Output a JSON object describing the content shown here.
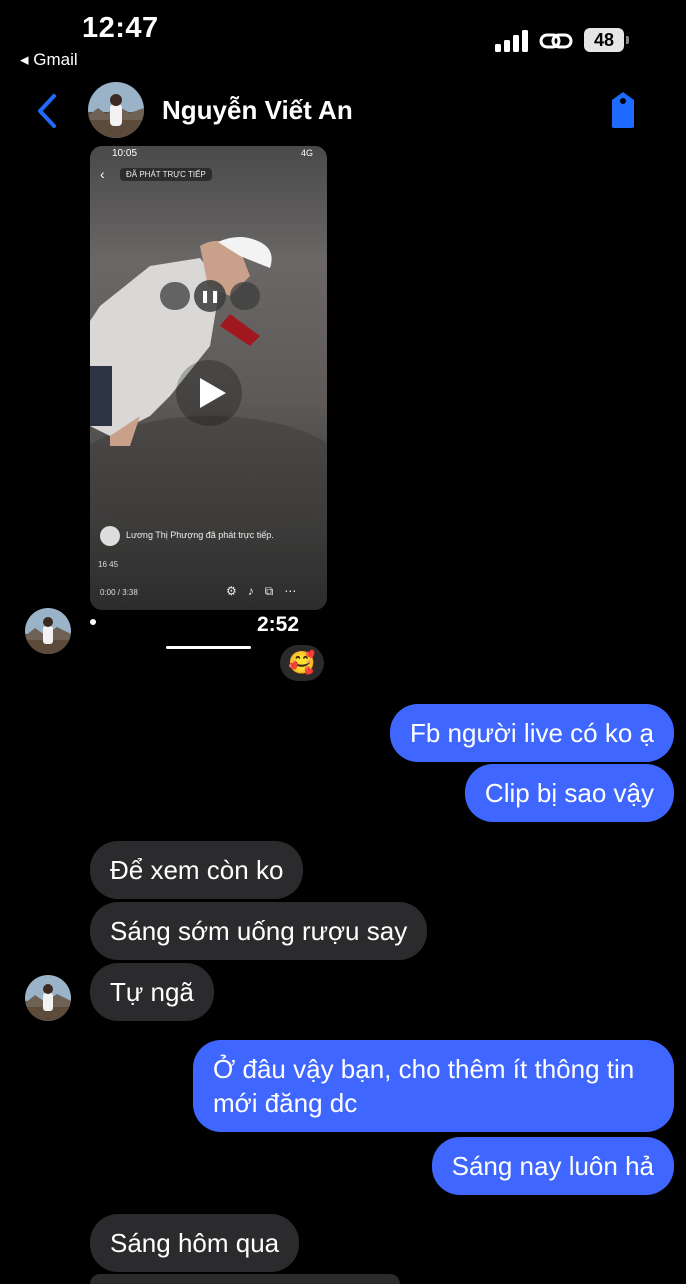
{
  "status_bar": {
    "time": "12:47",
    "back_app": "◂ Gmail",
    "battery": "48"
  },
  "header": {
    "contact_name": "Nguyễn Viết An"
  },
  "video": {
    "status_time": "10:05",
    "status_right": "4G",
    "live_label": "ĐÃ PHÁT TRỰC TIẾP",
    "caption": "Lương Thị Phượng đã phát trực tiếp.",
    "counts": "16  45",
    "position": "0:00 / 3:38",
    "remaining": "2:52",
    "reaction": "🥰"
  },
  "messages": {
    "m1": "Fb người live có ko ạ",
    "m2": "Clip bị sao vậy",
    "m3": "Để xem còn ko",
    "m4": "Sáng sớm uống rượu say",
    "m5": "Tự ngã",
    "m6_line1": "Ở đâu vậy bạn, cho thêm ít thông tin",
    "m6_line2": "mới đăng dc",
    "m7": "Sáng nay luôn hả",
    "m8": "Sáng hôm qua"
  },
  "colors": {
    "outgoing": "#3f67ff",
    "incoming": "#2b2b2d",
    "accent": "#1f6bff"
  }
}
